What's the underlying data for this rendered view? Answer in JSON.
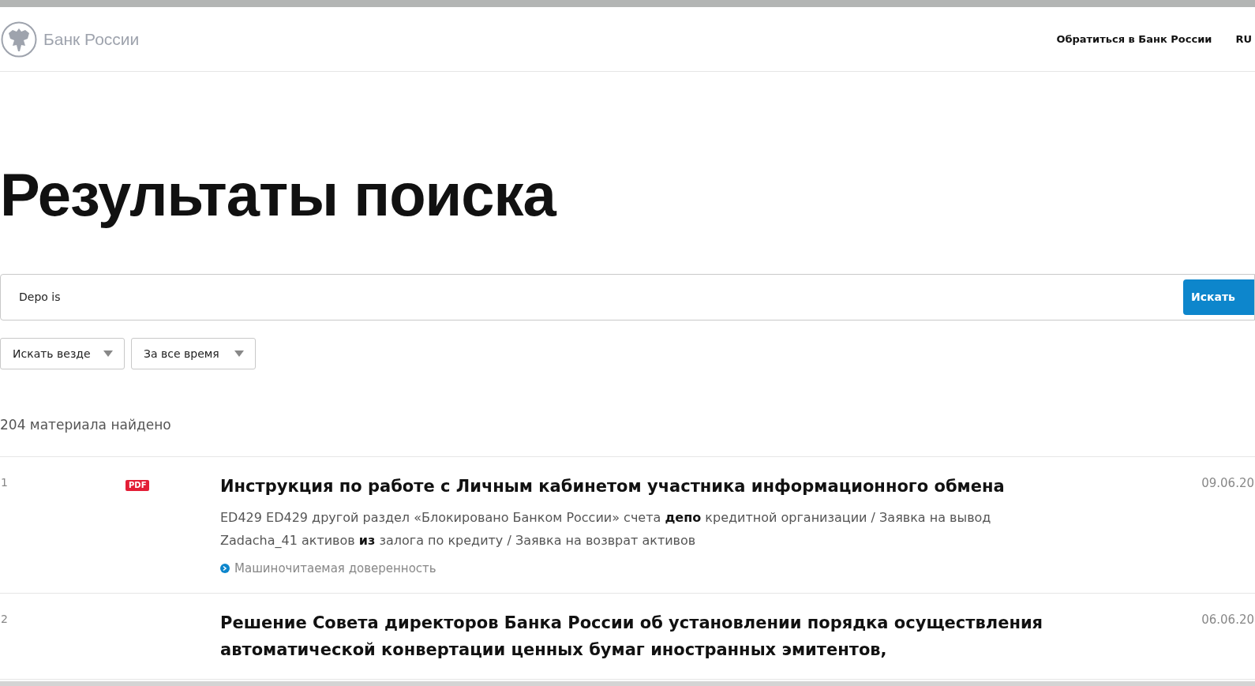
{
  "header": {
    "logo_text": "Банк России",
    "nav": [
      {
        "label": "Обратиться в Банк России"
      },
      {
        "label": "RU"
      }
    ]
  },
  "page_title": "Результаты поиска",
  "search": {
    "value": "Depo is",
    "button": "Искать"
  },
  "filters": [
    {
      "label": "Искать везде"
    },
    {
      "label": "За все время"
    }
  ],
  "result_count": "204 материала найдено",
  "results": [
    {
      "number": "1",
      "badge": "PDF",
      "title_lines": [
        "Инструкция по работе с Личным кабинетом участника информационного обмена"
      ],
      "snippet": "ED429 ED429 другой раздел «Блокировано Банком России» счета **депо** кредитной организации / Заявка на вывод Zadacha_41 активов **из** залога по кредиту / Заявка на возврат активов",
      "link": "Машиночитаемая доверенность",
      "date": "09.06.20"
    },
    {
      "number": "2",
      "title_lines": [
        "Решение Совета директоров Банка России об установлении порядка осуществления",
        "автоматической конвертации ценных бумаг иностранных эмитентов,"
      ],
      "date": "06.06.20"
    }
  ]
}
